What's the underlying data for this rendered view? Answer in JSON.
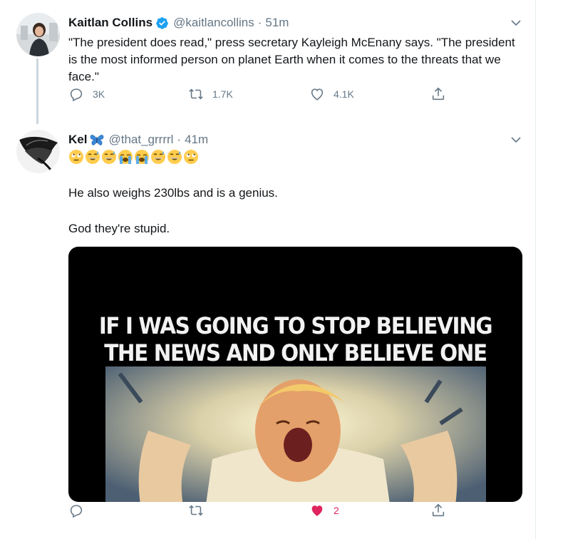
{
  "tweets": [
    {
      "display_name": "Kaitlan Collins",
      "handle": "@kaitlancollins",
      "separator": "·",
      "time": "51m",
      "verified": true,
      "text": "\"The president does read,\" press secretary Kayleigh McEnany says. \"The president is the most informed person on planet Earth when it comes to the threats that we face.\"",
      "actions": {
        "reply": "3K",
        "retweet": "1.7K",
        "like": "4.1K",
        "share": ""
      }
    },
    {
      "display_name": "Kel",
      "handle": "@that_grrrrl",
      "separator": "·",
      "time": "41m",
      "name_icon": "butterfly-icon",
      "emojis": [
        "rolling-eyes",
        "sweat-smile",
        "sweat-smile",
        "loudly-crying",
        "loudly-crying",
        "sweat-smile",
        "sweat-smile",
        "rolling-eyes"
      ],
      "paragraphs": [
        "He also weighs 230lbs and is a genius.",
        "God they're stupid."
      ],
      "media": {
        "caption_line1": "IF I WAS GOING TO STOP BELIEVING",
        "caption_line2": "THE NEWS AND ONLY BELIEVE ONE PERSON"
      },
      "actions": {
        "reply": "",
        "retweet": "",
        "like": "2",
        "share": ""
      },
      "liked": true
    }
  ],
  "colors": {
    "text": "#14171a",
    "secondary": "#657786",
    "verified": "#1da1f2",
    "like": "#e0245e",
    "thread": "#ccd6dd"
  }
}
